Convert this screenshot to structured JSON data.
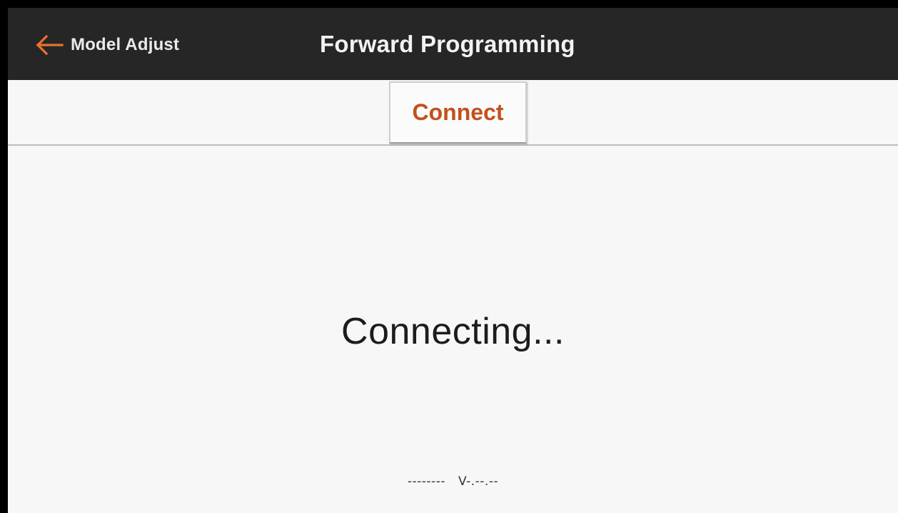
{
  "header": {
    "back_label": "Model Adjust",
    "back_icon": "arrow-left-icon",
    "title": "Forward Programming"
  },
  "tabs": {
    "connect_label": "Connect"
  },
  "main": {
    "status": "Connecting...",
    "device_name": "--------",
    "version": "V-.--.--"
  },
  "colors": {
    "accent": "#c4501c",
    "titlebar": "#262626",
    "background": "#f7f7f7",
    "back_arrow": "#e8732c"
  }
}
